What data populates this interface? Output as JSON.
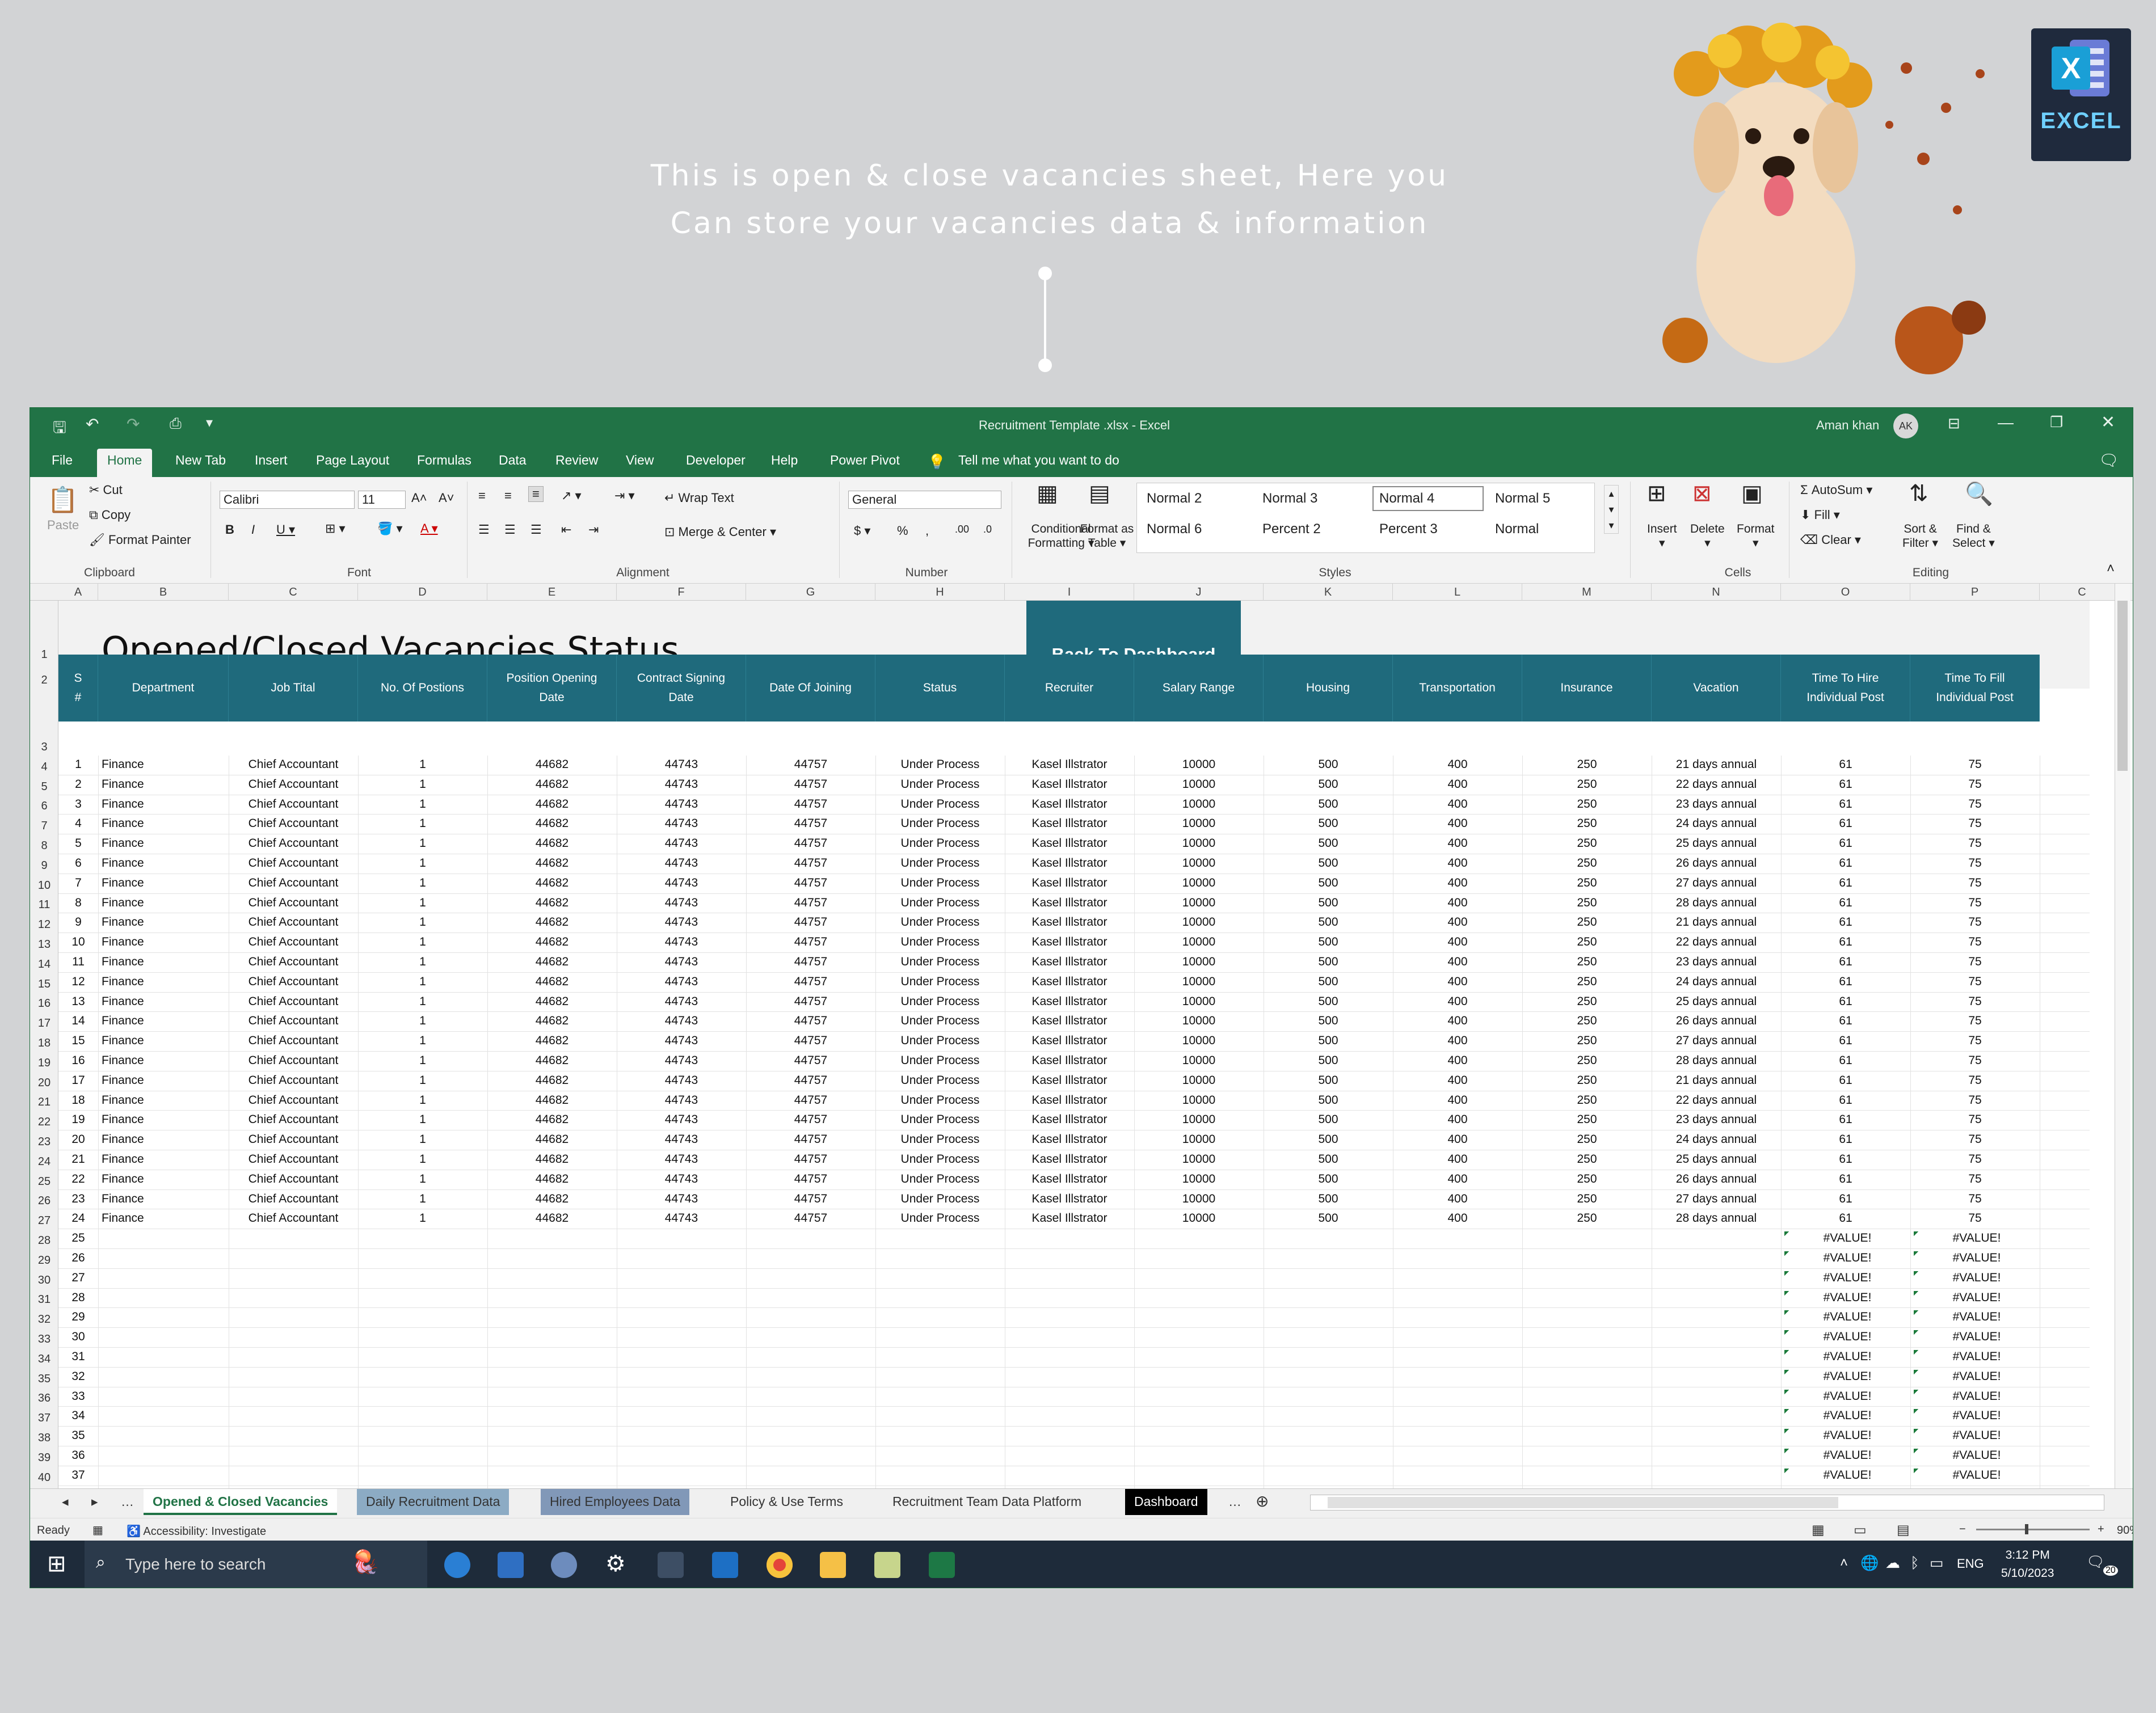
{
  "caption": {
    "line1": "This is open & close vacancies sheet, Here you",
    "line2": "Can store your vacancies data & information"
  },
  "logo": {
    "letter": "X",
    "text": "EXCEL"
  },
  "titlebar": {
    "file": "Recruitment Template .xlsx  -  Excel",
    "user": "Aman khan",
    "initials": "AK"
  },
  "ribbon_tabs": [
    "File",
    "Home",
    "New Tab",
    "Insert",
    "Page Layout",
    "Formulas",
    "Data",
    "Review",
    "View",
    "Developer",
    "Help",
    "Power Pivot"
  ],
  "tell_me": "Tell me what you want to do",
  "clipboard": {
    "paste": "Paste",
    "cut": "Cut",
    "copy": "Copy",
    "painter": "Format Painter",
    "label": "Clipboard"
  },
  "font": {
    "name": "Calibri",
    "size": "11",
    "label": "Font"
  },
  "alignment": {
    "wrap": "Wrap Text",
    "merge": "Merge & Center",
    "label": "Alignment"
  },
  "number": {
    "format": "General",
    "label": "Number"
  },
  "styles": {
    "cond1": "Conditional",
    "cond2": "Formatting",
    "table1": "Format as",
    "table2": "Table",
    "cells": [
      "Normal 2",
      "Normal 3",
      "Normal 4",
      "Normal 5",
      "Normal 6",
      "Percent 2",
      "Percent 3",
      "Normal"
    ],
    "label": "Styles"
  },
  "cells_grp": {
    "insert": "Insert",
    "delete": "Delete",
    "format": "Format",
    "label": "Cells"
  },
  "editing": {
    "autosum": "AutoSum",
    "fill": "Fill",
    "clear": "Clear",
    "sort1": "Sort &",
    "sort2": "Filter",
    "find1": "Find &",
    "find2": "Select",
    "label": "Editing"
  },
  "columns": [
    "A",
    "B",
    "C",
    "D",
    "E",
    "F",
    "G",
    "H",
    "I",
    "J",
    "K",
    "L",
    "M",
    "N",
    "O",
    "P",
    "C"
  ],
  "sheet": {
    "title": "Opened/Closed Vacancies Status",
    "back_button": "Back To Dashboard"
  },
  "table_headers": [
    "S #",
    "Department",
    "Job Tital",
    "No. Of Postions",
    "Position Opening Date",
    "Contract Signing Date",
    "Date Of Joining",
    "Status",
    "Recruiter",
    "Salary Range",
    "Housing",
    "Transportation",
    "Insurance",
    "Vacation",
    "Time To Hire Individual Post",
    "Time To Fill Individual Post"
  ],
  "row_template": {
    "department": "Finance",
    "job": "Chief Accountant",
    "positions": "1",
    "opening": "44682",
    "contract": "44743",
    "joining": "44757",
    "status": "Under Process",
    "recruiter": "Kasel Illstrator",
    "salary": "10000",
    "housing": "500",
    "transport": "400",
    "insurance": "250",
    "hire": "61",
    "fill": "75"
  },
  "vacations": [
    "21 days annual",
    "22 days annual",
    "23 days annual",
    "24 days annual",
    "25 days annual",
    "26 days annual",
    "27 days annual",
    "28 days annual",
    "21 days annual",
    "22 days annual",
    "23 days annual",
    "24 days annual",
    "25 days annual",
    "26 days annual",
    "27 days annual",
    "28 days annual",
    "21 days annual",
    "22 days annual",
    "23 days annual",
    "24 days annual",
    "25 days annual",
    "26 days annual",
    "27 days annual",
    "28 days annual"
  ],
  "error_value": "#VALUE!",
  "sheet_tabs": [
    "Opened & Closed Vacancies",
    "Daily Recruitment Data",
    "Hired Employees Data",
    "Policy & Use Terms",
    "Recruitment Team Data Platform",
    "Dashboard"
  ],
  "status": {
    "ready": "Ready",
    "accessibility": "Accessibility: Investigate",
    "zoom": "90%"
  },
  "taskbar": {
    "search": "Type here to search",
    "time": "3:12 PM",
    "date": "5/10/2023",
    "lang": "ENG",
    "notif": "20"
  }
}
